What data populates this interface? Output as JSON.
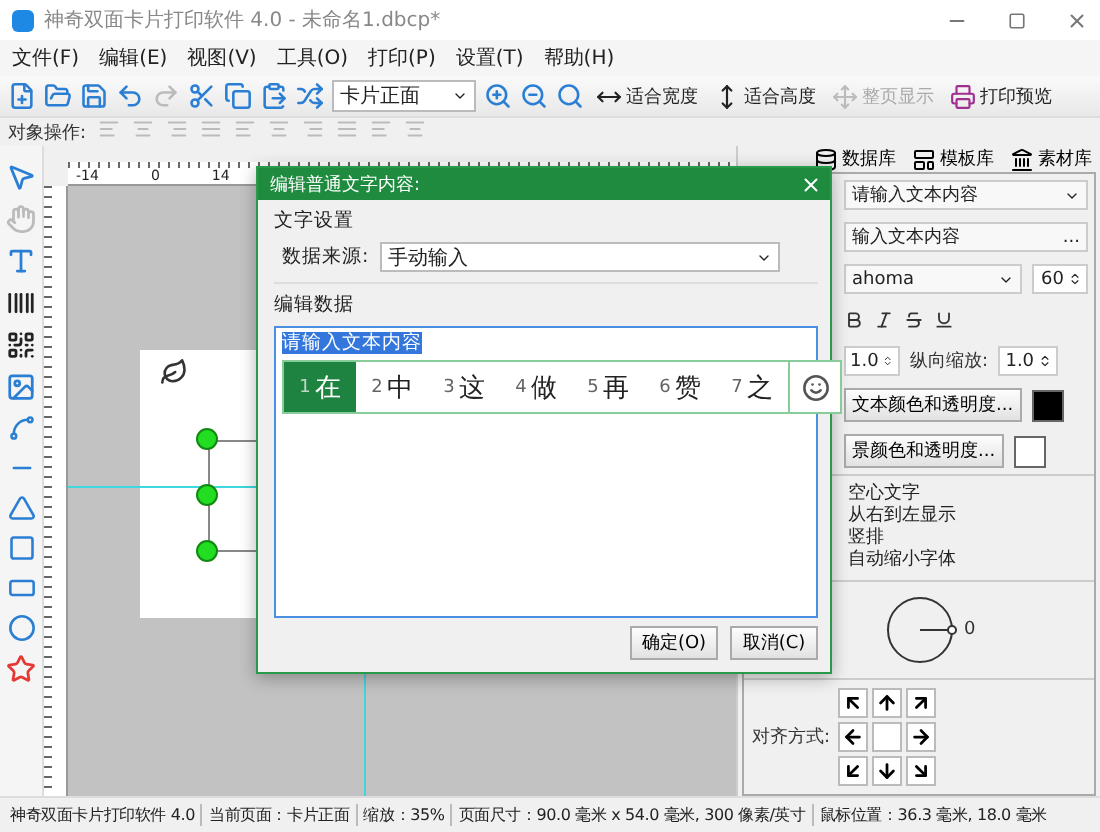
{
  "window": {
    "title": "神奇双面卡片打印软件 4.0 - 未命名1.dbcp*"
  },
  "menu": [
    "文件(F)",
    "编辑(E)",
    "视图(V)",
    "工具(O)",
    "打印(P)",
    "设置(T)",
    "帮助(H)"
  ],
  "toolbar": {
    "page_select": "卡片正面",
    "buttons": [
      {
        "kind": "width",
        "label": "适合宽度",
        "disabled": false
      },
      {
        "kind": "height",
        "label": "适合高度",
        "disabled": false
      },
      {
        "kind": "page",
        "label": "整页显示",
        "disabled": true
      },
      {
        "kind": "print",
        "label": "打印预览",
        "disabled": false
      }
    ]
  },
  "object_toolbar": {
    "label": "对象操作:"
  },
  "ruler": {
    "labels": [
      "-14",
      "0",
      "14"
    ]
  },
  "dialog": {
    "title": "编辑普通文字内容:",
    "section": "文字设置",
    "source_label": "数据来源:",
    "source_value": "手动输入",
    "data_label": "编辑数据",
    "text": "请输入文本内容",
    "buttons": [
      "确定(O)",
      "取消(C)"
    ]
  },
  "ime": {
    "candidates": [
      {
        "index": "1",
        "text": "在",
        "selected": true
      },
      {
        "index": "2",
        "text": "中",
        "selected": false
      },
      {
        "index": "3",
        "text": "这",
        "selected": false
      },
      {
        "index": "4",
        "text": "做",
        "selected": false
      },
      {
        "index": "5",
        "text": "再",
        "selected": false
      },
      {
        "index": "6",
        "text": "赞",
        "selected": false
      },
      {
        "index": "7",
        "text": "之",
        "selected": false
      }
    ]
  },
  "right_panel": {
    "tabs": [
      {
        "kind": "database",
        "label": "数据库"
      },
      {
        "kind": "template",
        "label": "模板库"
      },
      {
        "kind": "material",
        "label": "素材库"
      }
    ],
    "text_select": "请输入文本内容",
    "text_field": "输入文本内容",
    "more": "...",
    "font": "ahoma",
    "size": "60",
    "h_scale": "1.0",
    "v_scale_label": "纵向缩放:",
    "v_scale": "1.0",
    "color_buttons": [
      {
        "label": "文本颜色和透明度...",
        "color": "#000000"
      },
      {
        "label": "景颜色和透明度...",
        "color": "#ffffff"
      }
    ],
    "options": [
      "空心文字",
      "从右到左显示",
      "竖排",
      "自动缩小字体"
    ],
    "rotation": "0",
    "align_label": "对齐方式:"
  },
  "status_bar": [
    "神奇双面卡片打印软件 4.0",
    "当前页面：卡片正面",
    "缩放：35%",
    "页面尺寸：90.0 毫米 x 54.0 毫米, 300 像素/英寸",
    "鼠标位置：36.3 毫米, 18.0 毫米"
  ]
}
